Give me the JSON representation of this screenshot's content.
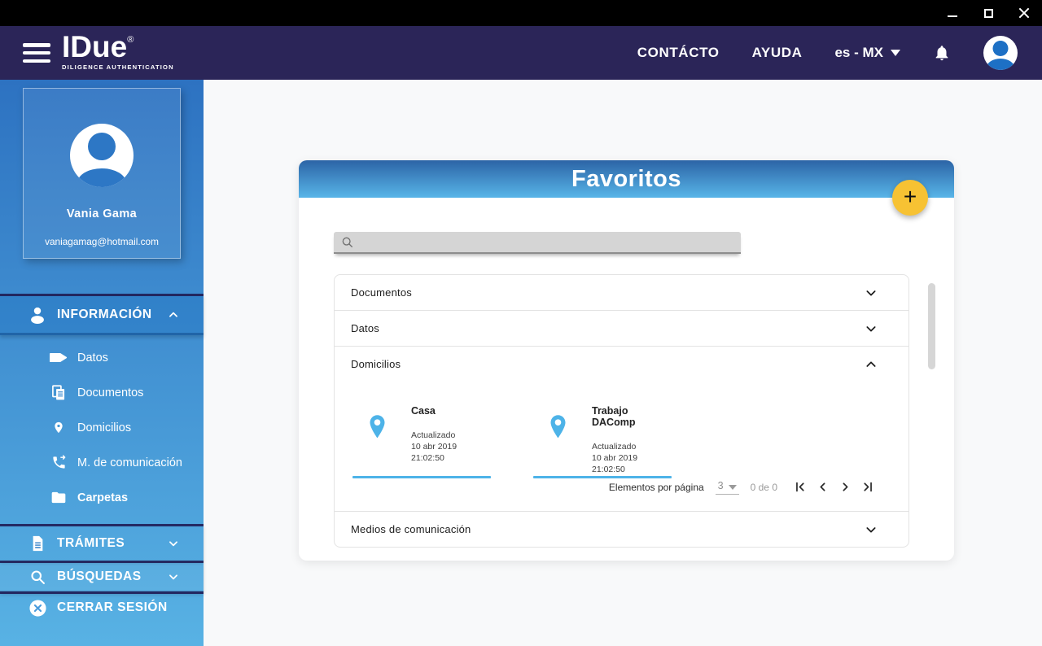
{
  "titlebar": {
    "icons": [
      "minimize-icon",
      "maximize-icon",
      "close-icon"
    ]
  },
  "header": {
    "logo": {
      "title": "IDue",
      "registered": "®",
      "tagline": "DILIGENCE AUTHENTICATION"
    },
    "nav": [
      {
        "label": "CONTÁCTO"
      },
      {
        "label": "AYUDA"
      }
    ],
    "language": {
      "selected": "es - MX"
    },
    "icons": {
      "menu": "hamburger-icon",
      "notifications": "bell-icon",
      "account": "avatar"
    }
  },
  "sidebar": {
    "profile": {
      "name": "Vania Gama",
      "email": "vaniagamag@hotmail.com"
    },
    "sections": [
      {
        "label": "INFORMACIÓN",
        "icon": "person-icon",
        "state": "expanded",
        "items": [
          {
            "label": "Datos",
            "icon": "tag-icon",
            "active": false
          },
          {
            "label": "Documentos",
            "icon": "copy-icon",
            "active": false
          },
          {
            "label": "Domicilios",
            "icon": "pin-icon",
            "active": false
          },
          {
            "label": "M. de comunicación",
            "icon": "phone-icon",
            "active": false
          },
          {
            "label": "Carpetas",
            "icon": "folder-icon",
            "active": true
          }
        ]
      },
      {
        "label": "TRÁMITES",
        "icon": "document-icon",
        "state": "collapsed"
      },
      {
        "label": "BÚSQUEDAS",
        "icon": "search-icon",
        "state": "collapsed"
      }
    ],
    "logout": {
      "label": "CERRAR SESIÓN",
      "icon": "close-circle-icon"
    }
  },
  "main": {
    "card": {
      "title": "Favoritos",
      "add_button": "+",
      "search": {
        "value": "",
        "placeholder": ""
      },
      "accordion": [
        {
          "label": "Documentos",
          "expanded": false
        },
        {
          "label": "Datos",
          "expanded": false
        },
        {
          "label": "Domicilios",
          "expanded": true,
          "items": [
            {
              "title": "Casa",
              "updated_label": "Actualizado",
              "updated_at": "10 abr 2019 21:02:50"
            },
            {
              "title": "Trabajo DAComp",
              "updated_label": "Actualizado",
              "updated_at": "10 abr 2019 21:02:50"
            }
          ],
          "pagination": {
            "items_per_page_label": "Elementos por página",
            "page_size": "3",
            "range_label": "0 de 0",
            "buttons": [
              "first-page-icon",
              "previous-page-icon",
              "next-page-icon",
              "last-page-icon"
            ]
          }
        },
        {
          "label": "Medios de comunicación",
          "expanded": false
        }
      ]
    }
  },
  "colors": {
    "titlebar_bg": "#000000",
    "header_bg": "#2B2558",
    "sidebar_gradient_top": "#2D72C1",
    "sidebar_gradient_bottom": "#58B2E4",
    "card_header_gradient_top": "#2C64A6",
    "card_header_gradient_bottom": "#58B5E8",
    "accent_amber": "#F7C233",
    "pin_blue": "#4DB3E8",
    "avatar_blue": "#1D70C5",
    "content_bg": "#F8F9FA"
  }
}
